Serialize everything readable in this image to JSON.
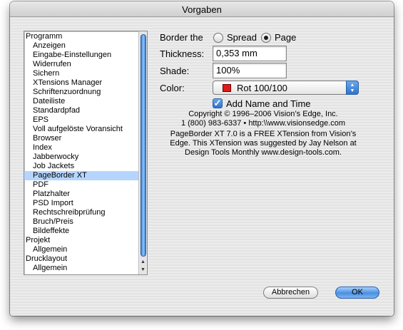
{
  "window": {
    "title": "Vorgaben"
  },
  "sidebar": {
    "items": [
      {
        "label": "Programm",
        "level": 0,
        "selected": false
      },
      {
        "label": "Anzeigen",
        "level": 1,
        "selected": false
      },
      {
        "label": "Eingabe-Einstellungen",
        "level": 1,
        "selected": false
      },
      {
        "label": "Widerrufen",
        "level": 1,
        "selected": false
      },
      {
        "label": "Sichern",
        "level": 1,
        "selected": false
      },
      {
        "label": "XTensions Manager",
        "level": 1,
        "selected": false
      },
      {
        "label": "Schriftenzuordnung",
        "level": 1,
        "selected": false
      },
      {
        "label": "Dateiliste",
        "level": 1,
        "selected": false
      },
      {
        "label": "Standardpfad",
        "level": 1,
        "selected": false
      },
      {
        "label": "EPS",
        "level": 1,
        "selected": false
      },
      {
        "label": "Voll aufgelöste Voransicht",
        "level": 1,
        "selected": false
      },
      {
        "label": "Browser",
        "level": 1,
        "selected": false
      },
      {
        "label": "Index",
        "level": 1,
        "selected": false
      },
      {
        "label": "Jabberwocky",
        "level": 1,
        "selected": false
      },
      {
        "label": "Job Jackets",
        "level": 1,
        "selected": false
      },
      {
        "label": "PageBorder XT",
        "level": 1,
        "selected": true
      },
      {
        "label": "PDF",
        "level": 1,
        "selected": false
      },
      {
        "label": "Platzhalter",
        "level": 1,
        "selected": false
      },
      {
        "label": "PSD Import",
        "level": 1,
        "selected": false
      },
      {
        "label": "Rechtschreibprüfung",
        "level": 1,
        "selected": false
      },
      {
        "label": "Bruch/Preis",
        "level": 1,
        "selected": false
      },
      {
        "label": "Bildeffekte",
        "level": 1,
        "selected": false
      },
      {
        "label": "Projekt",
        "level": 0,
        "selected": false
      },
      {
        "label": "Allgemein",
        "level": 1,
        "selected": false
      },
      {
        "label": "Drucklayout",
        "level": 0,
        "selected": false
      },
      {
        "label": "Allgemein",
        "level": 1,
        "selected": false
      }
    ]
  },
  "pane": {
    "border_label": "Border the",
    "radio_spread": "Spread",
    "radio_page": "Page",
    "selected_radio": "Page",
    "thickness_label": "Thickness:",
    "thickness_value": "0,353 mm",
    "shade_label": "Shade:",
    "shade_value": "100%",
    "color_label": "Color:",
    "color_value": "Rot 100/100",
    "color_swatch": "#e11919",
    "checkbox_label": "Add Name and Time",
    "checkbox_checked": true,
    "copyright": "Copyright © 1996–2006 Vision’s Edge, Inc.",
    "contact": "1 (800) 983-6337  •  http:\\\\www.visionsedge.com",
    "desc_line1": "PageBorder XT 7.0 is a FREE XTension from Vision’s",
    "desc_line2": "Edge. This XTension was suggested by Jay Nelson at",
    "desc_line3": "Design Tools Monthly www.design-tools.com."
  },
  "buttons": {
    "cancel": "Abbrechen",
    "ok": "OK"
  },
  "colors": {
    "accent": "#3e80d4",
    "selection": "#b5d5ff"
  }
}
